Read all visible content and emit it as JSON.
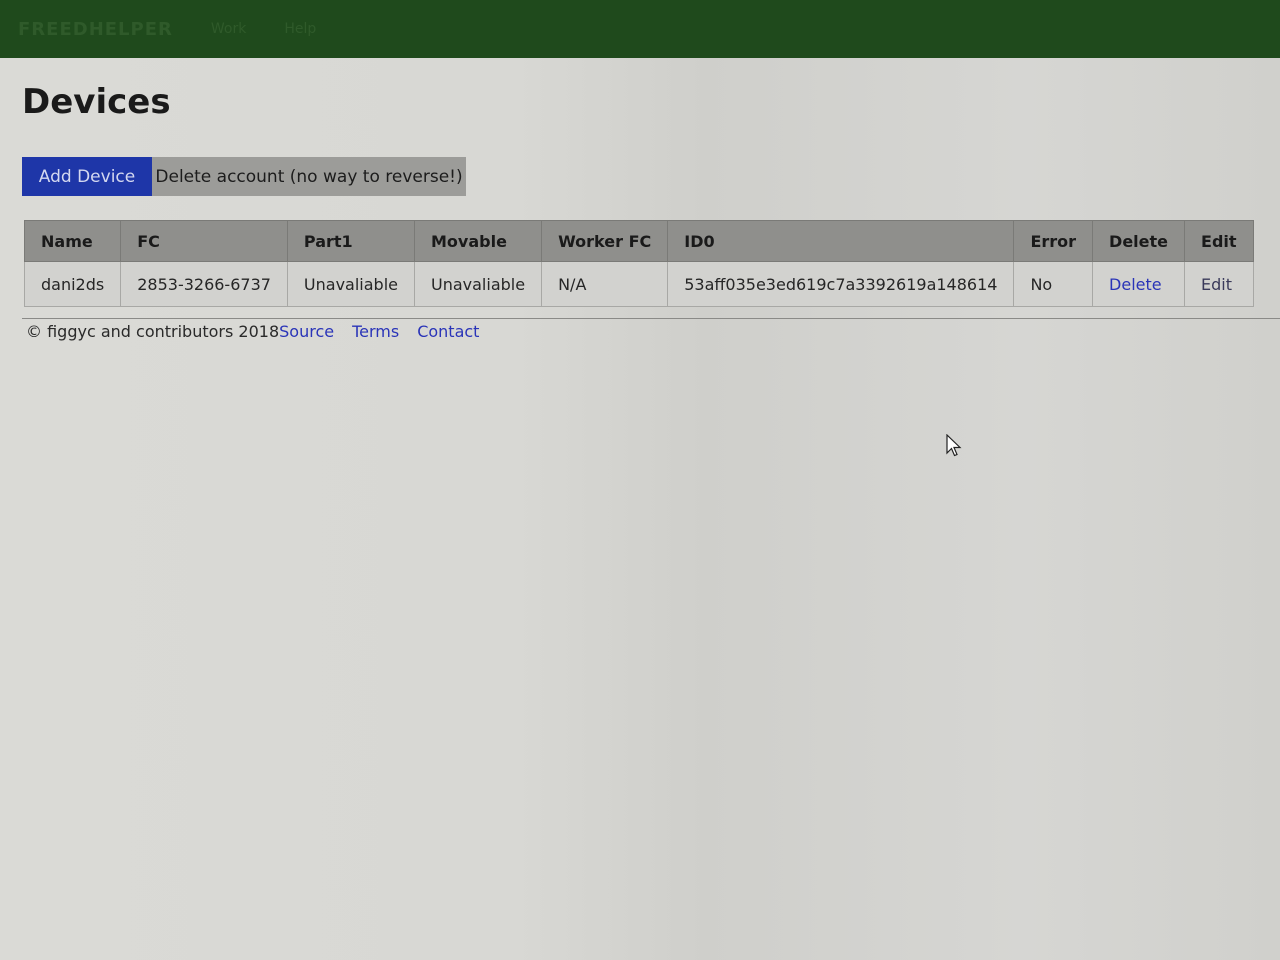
{
  "header": {
    "brand": "FREEDHELPER",
    "nav": [
      "Work",
      "Help"
    ]
  },
  "page": {
    "title": "Devices"
  },
  "actions": {
    "add_device": "Add Device",
    "delete_account": "Delete account (no way to reverse!)"
  },
  "table": {
    "columns": [
      "Name",
      "FC",
      "Part1",
      "Movable",
      "Worker FC",
      "ID0",
      "Error",
      "Delete",
      "Edit"
    ],
    "rows": [
      {
        "name": "dani2ds",
        "fc": "2853-3266-6737",
        "part1": "Unavaliable",
        "movable": "Unavaliable",
        "worker_fc": "N/A",
        "id0": "53aff035e3ed619c7a3392619a148614",
        "error": "No",
        "delete": "Delete",
        "edit": "Edit"
      }
    ]
  },
  "footer": {
    "copyright": "© figgyc and contributors 2018",
    "links": [
      "Source",
      "Terms",
      "Contact"
    ]
  },
  "colors": {
    "navbar": "#1f4a1c",
    "primary_button": "#1e36a8",
    "link": "#2a34b8"
  }
}
